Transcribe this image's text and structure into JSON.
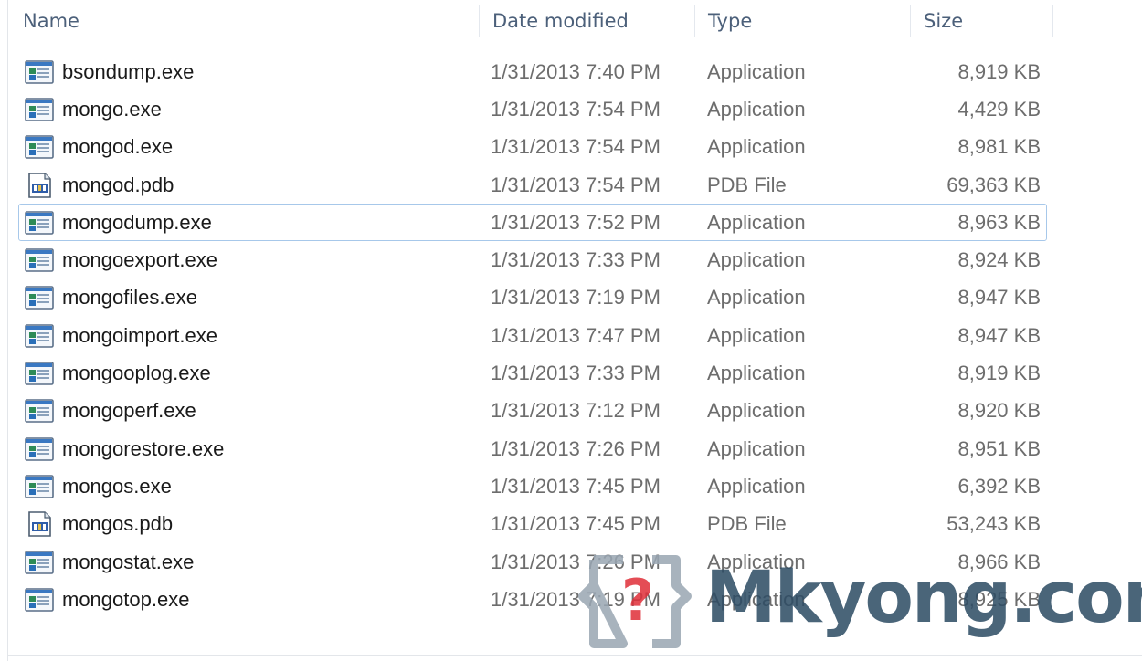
{
  "columns": {
    "name": "Name",
    "date": "Date modified",
    "type": "Type",
    "size": "Size"
  },
  "files": [
    {
      "name": "bsondump.exe",
      "date": "1/31/2013 7:40 PM",
      "type": "Application",
      "size": "8,919 KB",
      "icon": "application-icon"
    },
    {
      "name": "mongo.exe",
      "date": "1/31/2013 7:54 PM",
      "type": "Application",
      "size": "4,429 KB",
      "icon": "application-icon"
    },
    {
      "name": "mongod.exe",
      "date": "1/31/2013 7:54 PM",
      "type": "Application",
      "size": "8,981 KB",
      "icon": "application-icon"
    },
    {
      "name": "mongod.pdb",
      "date": "1/31/2013 7:54 PM",
      "type": "PDB File",
      "size": "69,363 KB",
      "icon": "pdb-file-icon"
    },
    {
      "name": "mongodump.exe",
      "date": "1/31/2013 7:52 PM",
      "type": "Application",
      "size": "8,963 KB",
      "icon": "application-icon",
      "focused": true
    },
    {
      "name": "mongoexport.exe",
      "date": "1/31/2013 7:33 PM",
      "type": "Application",
      "size": "8,924 KB",
      "icon": "application-icon"
    },
    {
      "name": "mongofiles.exe",
      "date": "1/31/2013 7:19 PM",
      "type": "Application",
      "size": "8,947 KB",
      "icon": "application-icon"
    },
    {
      "name": "mongoimport.exe",
      "date": "1/31/2013 7:47 PM",
      "type": "Application",
      "size": "8,947 KB",
      "icon": "application-icon"
    },
    {
      "name": "mongooplog.exe",
      "date": "1/31/2013 7:33 PM",
      "type": "Application",
      "size": "8,919 KB",
      "icon": "application-icon"
    },
    {
      "name": "mongoperf.exe",
      "date": "1/31/2013 7:12 PM",
      "type": "Application",
      "size": "8,920 KB",
      "icon": "application-icon"
    },
    {
      "name": "mongorestore.exe",
      "date": "1/31/2013 7:26 PM",
      "type": "Application",
      "size": "8,951 KB",
      "icon": "application-icon"
    },
    {
      "name": "mongos.exe",
      "date": "1/31/2013 7:45 PM",
      "type": "Application",
      "size": "6,392 KB",
      "icon": "application-icon"
    },
    {
      "name": "mongos.pdb",
      "date": "1/31/2013 7:45 PM",
      "type": "PDB File",
      "size": "53,243 KB",
      "icon": "pdb-file-icon"
    },
    {
      "name": "mongostat.exe",
      "date": "1/31/2013 7:26 PM",
      "type": "Application",
      "size": "8,966 KB",
      "icon": "application-icon"
    },
    {
      "name": "mongotop.exe",
      "date": "1/31/2013 7:19 PM",
      "type": "Application",
      "size": "8,925 KB",
      "icon": "application-icon"
    }
  ],
  "watermark": {
    "text": "Mkyong.com",
    "brand_color": "#2d4c64",
    "accent_color": "#e0303a"
  }
}
